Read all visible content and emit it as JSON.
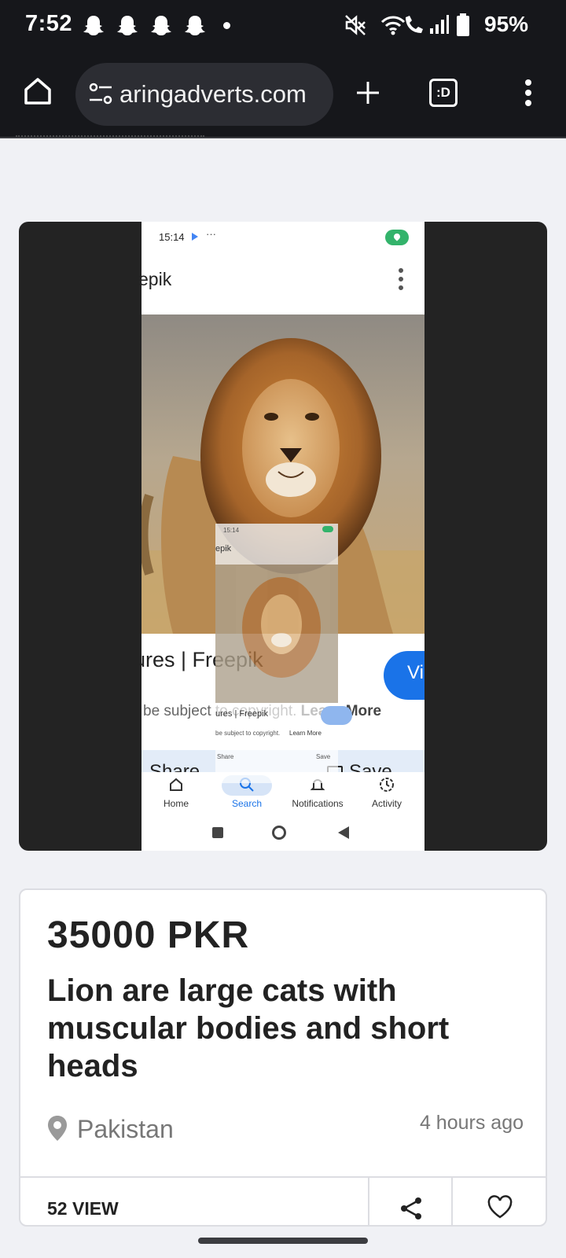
{
  "status_bar": {
    "time": "7:52",
    "notification_icons": [
      "snapchat-icon",
      "snapchat-icon",
      "snapchat-icon",
      "snapchat-icon"
    ],
    "battery_percent": "95%"
  },
  "browser": {
    "url": "aringadverts.com",
    "tab_count_label": ":D"
  },
  "listing": {
    "price": "35000 PKR",
    "title": "Lion are large cats with muscular bodies and short heads",
    "location": "Pakistan",
    "posted": "4 hours ago",
    "views": "52 VIEW"
  },
  "screenshot_image": {
    "time": "15:14",
    "more": "···",
    "app_title": "epik",
    "caption": "ures | Freepik",
    "visit_label": "Vi",
    "copyright_text": "be subject to copyright.",
    "learn_more": "Learn More",
    "share_label": "Share",
    "save_label": "Save",
    "nav": [
      "Home",
      "Search",
      "Notifications",
      "Activity"
    ],
    "overlay_time": "15:14",
    "overlay_title": "epik",
    "overlay_caption": "ures | Freepik",
    "overlay_copy": "be subject to copyright.",
    "overlay_learn": "Learn More",
    "overlay_share": "Share",
    "overlay_save": "Save"
  },
  "colors": {
    "status_bg": "#16171b",
    "page_bg": "#f0f1f5",
    "accent_blue": "#1a73e8",
    "text_dark": "#222222",
    "text_muted": "#777777"
  }
}
